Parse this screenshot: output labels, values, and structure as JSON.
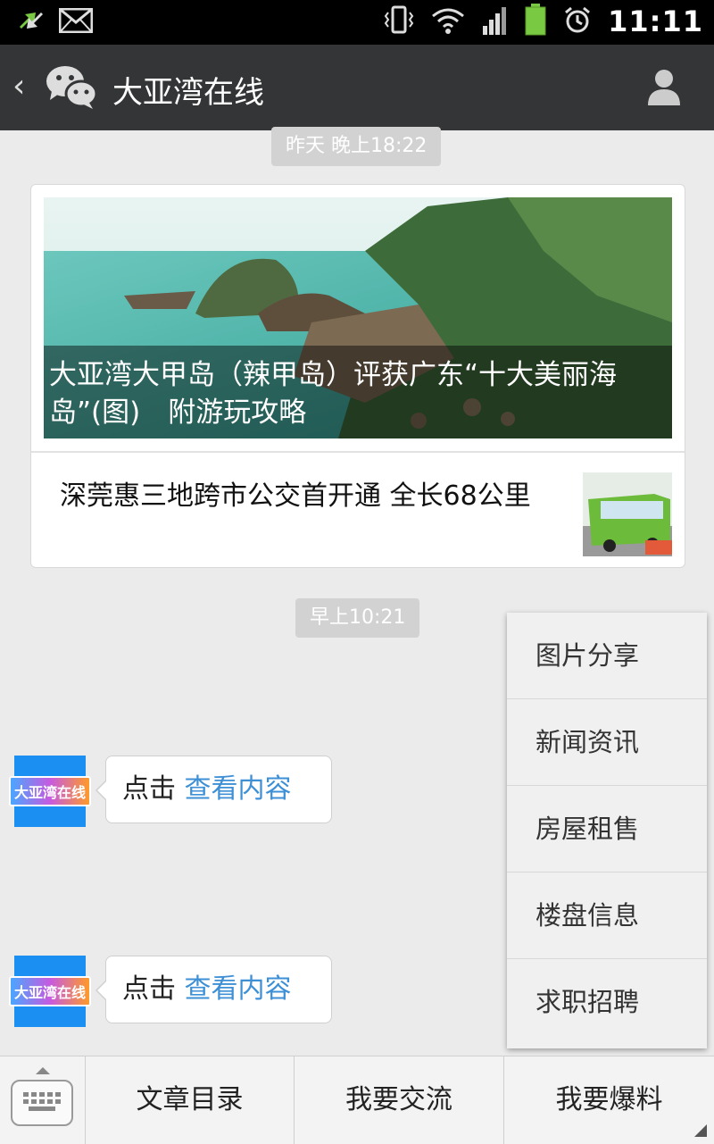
{
  "status_bar": {
    "time": "11:11"
  },
  "header": {
    "back_icon": "chevron-left-icon",
    "app_icon": "wechat-icon",
    "title": "大亚湾在线",
    "profile_icon": "person-icon"
  },
  "timestamps": [
    "昨天 晚上18:22",
    "早上10:21"
  ],
  "news_card": {
    "headline": "大亚湾大甲岛（辣甲岛）评获广东“十大美丽海岛”(图)　附游玩攻略",
    "second_title": "深莞惠三地跨市公交首开通 全长68公里"
  },
  "messages": [
    {
      "avatar_text": "大亚湾在线",
      "prefix": "点击 ",
      "link": "查看内容"
    },
    {
      "avatar_text": "大亚湾在线",
      "prefix": "点击 ",
      "link": "查看内容"
    }
  ],
  "popup_menu": [
    "图片分享",
    "新闻资讯",
    "房屋租售",
    "楼盘信息",
    "求职招聘"
  ],
  "bottom_menu": {
    "keyboard_icon": "keyboard-icon",
    "items": [
      "文章目录",
      "我要交流",
      "我要爆料"
    ]
  },
  "colors": {
    "title_bar": "#333537",
    "link": "#3d8fd6",
    "background": "#ebebeb"
  }
}
